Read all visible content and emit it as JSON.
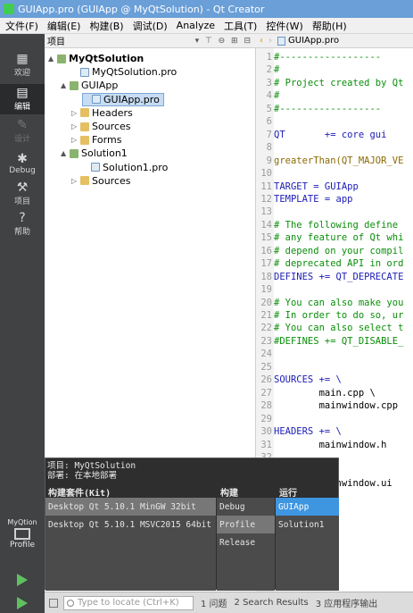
{
  "window": {
    "title": "GUIApp.pro (GUIApp @ MyQtSolution) - Qt Creator"
  },
  "menubar": [
    "文件(F)",
    "编辑(E)",
    "构建(B)",
    "调试(D)",
    "Analyze",
    "工具(T)",
    "控件(W)",
    "帮助(H)"
  ],
  "modes": {
    "welcome": "欢迎",
    "edit": "编辑",
    "design": "设计",
    "debug": "Debug",
    "projects": "项目",
    "help": "帮助"
  },
  "kit_selector": {
    "project": "MyQtion",
    "build": "Profile"
  },
  "projects_pane": {
    "title": "项目",
    "tools": "▾ ⊤ ⊖ ⊞ ⊟",
    "tree": [
      {
        "label": "MyQtSolution",
        "arrow": "▲",
        "icon": "proj"
      },
      {
        "label": "MyQtSolution.pro",
        "arrow": "",
        "icon": "pro"
      },
      {
        "label": "GUIApp",
        "arrow": "▲",
        "icon": "proj"
      },
      {
        "label": "GUIApp.pro",
        "arrow": "",
        "icon": "pro"
      },
      {
        "label": "Headers",
        "arrow": "▷",
        "icon": "folder"
      },
      {
        "label": "Sources",
        "arrow": "▷",
        "icon": "folder"
      },
      {
        "label": "Forms",
        "arrow": "▷",
        "icon": "folder"
      },
      {
        "label": "Solution1",
        "arrow": "▲",
        "icon": "proj"
      },
      {
        "label": "Solution1.pro",
        "arrow": "",
        "icon": "pro"
      },
      {
        "label": "Sources",
        "arrow": "▷",
        "icon": "folder"
      }
    ]
  },
  "editor": {
    "toolbar": {
      "back": "‹",
      "forward": "›",
      "file": "GUIApp.pro"
    },
    "lines": [
      {
        "n": "1",
        "t": "#------------------",
        "k": "comment"
      },
      {
        "n": "2",
        "t": "#",
        "k": "comment"
      },
      {
        "n": "3",
        "t": "# Project created by Qt",
        "k": "comment"
      },
      {
        "n": "4",
        "t": "#",
        "k": "comment"
      },
      {
        "n": "5",
        "t": "#------------------",
        "k": "comment"
      },
      {
        "n": "6",
        "t": "",
        "k": ""
      },
      {
        "n": "7",
        "t": "QT       += core gui",
        "k": "keyword"
      },
      {
        "n": "8",
        "t": "",
        "k": ""
      },
      {
        "n": "9",
        "t": "greaterThan(QT_MAJOR_VE",
        "k": "func"
      },
      {
        "n": "10",
        "t": "",
        "k": ""
      },
      {
        "n": "11",
        "t": "TARGET = GUIApp",
        "k": "keyword"
      },
      {
        "n": "12",
        "t": "TEMPLATE = app",
        "k": "keyword"
      },
      {
        "n": "13",
        "t": "",
        "k": ""
      },
      {
        "n": "14",
        "t": "# The following define",
        "k": "comment"
      },
      {
        "n": "15",
        "t": "# any feature of Qt whi",
        "k": "comment"
      },
      {
        "n": "16",
        "t": "# depend on your compil",
        "k": "comment"
      },
      {
        "n": "17",
        "t": "# deprecated API in ord",
        "k": "comment"
      },
      {
        "n": "18",
        "t": "DEFINES += QT_DEPRECATE",
        "k": "keyword"
      },
      {
        "n": "19",
        "t": "",
        "k": ""
      },
      {
        "n": "20",
        "t": "# You can also make you",
        "k": "comment"
      },
      {
        "n": "21",
        "t": "# In order to do so, ur",
        "k": "comment"
      },
      {
        "n": "22",
        "t": "# You can also select t",
        "k": "comment"
      },
      {
        "n": "23",
        "t": "#DEFINES += QT_DISABLE_",
        "k": "comment"
      },
      {
        "n": "24",
        "t": "",
        "k": ""
      },
      {
        "n": "25",
        "t": "",
        "k": ""
      },
      {
        "n": "26",
        "t": "SOURCES += \\",
        "k": "keyword"
      },
      {
        "n": "27",
        "t": "        main.cpp \\",
        "k": ""
      },
      {
        "n": "28",
        "t": "        mainwindow.cpp",
        "k": ""
      },
      {
        "n": "29",
        "t": "",
        "k": ""
      },
      {
        "n": "30",
        "t": "HEADERS += \\",
        "k": "keyword"
      },
      {
        "n": "31",
        "t": "        mainwindow.h",
        "k": ""
      },
      {
        "n": "32",
        "t": "",
        "k": ""
      },
      {
        "n": "33",
        "t": "",
        "k": ""
      },
      {
        "n": "34",
        "t": "        mainwindow.ui",
        "k": ""
      }
    ]
  },
  "kit_popup": {
    "project_line": "项目: MyQtSolution",
    "deploy_line": "部署: 在本地部署",
    "headers": {
      "kit": "构建套件(Kit)",
      "build": "构建",
      "run": "运行"
    },
    "kits": [
      "Desktop Qt 5.10.1 MinGW 32bit",
      "Desktop Qt 5.10.1 MSVC2015 64bit"
    ],
    "builds": [
      "Debug",
      "Profile",
      "Release"
    ],
    "runs": [
      "GUIApp",
      "Solution1"
    ]
  },
  "statusbar": {
    "locator_placeholder": "Type to locate (Ctrl+K)",
    "panes": [
      "1 问题",
      "2 Search Results",
      "3 应用程序输出"
    ]
  },
  "colors": {
    "titlebar": "#6a9fd8",
    "modebar": "#404244",
    "popup": "#2e2e2e",
    "selection_blue": "#3e95e0"
  }
}
